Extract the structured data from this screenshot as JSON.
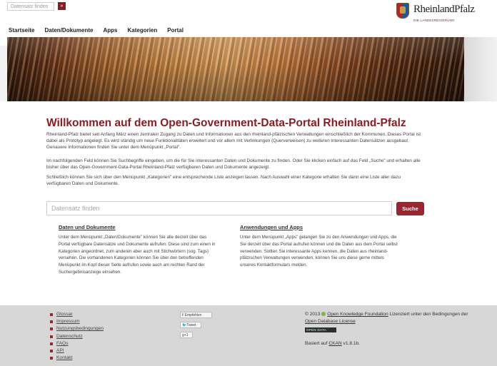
{
  "top": {
    "search_placeholder": "Datensatz finden",
    "search_button": "»"
  },
  "logo": {
    "name": "RheinlandPfalz",
    "subtitle": "DIE LANDESREGIERUNG"
  },
  "nav": [
    "Startseite",
    "Daten/Dokumente",
    "Apps",
    "Kategorien",
    "Portal"
  ],
  "main": {
    "title": "Willkommen auf dem Open-Government-Data-Portal Rheinland-Pfalz",
    "p1": "Rheinland-Pfalz bietet seit Anfang März einen zentralen Zugang zu Daten und Informationen aus den rheinland-pfälzischen Verwaltungen einschließlich der Kommunen. Dieses Portal ist dabei als Prototyp angelegt. Es wird ständig um neue Funktionalitäten erweitert und vor allem mit Verlinkungen (Querverweisen) zu weiteren interessanten Datensätzen ausgebaut. Genauere Informationen finden Sie unter dem Menüpunkt „Portal\".",
    "p2": "Im nachfolgenden Feld können Sie Suchbegriffe eingeben, um die für Sie interessanten Daten und Dokumente zu finden. Oder Sie klicken einfach auf das Feld „Suche\" und erhalten alle bisher über das Open-Government-Data-Portal Rheinland-Pfalz verfügbaren Daten und Dokumente angezeigt.",
    "p3": "Schließlich können Sie sich über den Menüpunkt „Kategorien\" eine entsprechende Liste anzeigen lassen. Nach Auswahl einer Kategorie erhalten Sie dann eine Liste aller dazu verfügbaren Daten und Dokumente.",
    "search_placeholder": "Datensatz finden",
    "search_button": "Suche",
    "col1_title": "Daten und Dokumente",
    "col1_text": "Unter dem Menüpunkt „Daten/Dokumente\" können Sie alle derzeit über das Portal verfügbare Datensätze und Dokumente aufrufen. Diese sind zum einen in Kategorien angeordnet, zum anderen aber auch mit Stichwörtern (sog. Tags) versehen. Die vorhandenen Kategorien können Sie über den betreffenden Menüpunkt im Kopf dieser Seite aufrufen sowie auch am rechten Rand der Suchergebnisanzeige einsehen.",
    "col2_title": "Anwendungen und Apps",
    "col2_text": "Unter dem Menüpunkt „Apps\" gelangen Sie zu den Anwendungen und Apps, die Sie derzeit über das Portal aufrufen können und die Daten aus dem Portal selbst verwenden. Sollten Sie interessante Apps kennen, die Daten aus rheinland-pfälzischen Verwaltungen verwenden, können Sie uns diese gerne mittels unseres Kontaktformulars melden."
  },
  "footer": {
    "links": [
      "Glossar",
      "Impressum",
      "Nutzungsbedingungen",
      "Datenschutz",
      "FAQs",
      "API",
      "Kontakt"
    ],
    "share_facebook": "Empfehlen",
    "share_twitter": "Tweet",
    "share_gplus": "+1",
    "copy_prefix": "© 2013",
    "okf": "Open Knowledge Foundation",
    "copy_mid": "Lizenziert unter den Bedingungen der",
    "odb_license": "Open Database License",
    "odb_badge": "OPEN DATA",
    "based_on": "Basiert auf",
    "ckan": "CKAN",
    "version": "v1.8.1b."
  }
}
